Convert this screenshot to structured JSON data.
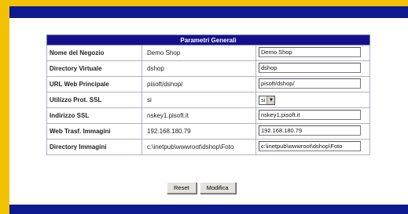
{
  "header": {
    "title": "Parametri Generali"
  },
  "rows": [
    {
      "label": "Nome del Negozio",
      "value": "Demo Shop",
      "field": "Demo Shop"
    },
    {
      "label": "Directory Virtuale",
      "value": "dshop",
      "field": "dshop"
    },
    {
      "label": "URL Web Principale",
      "value": "pisoft/dshop/",
      "field": "pisoft/dshop/"
    },
    {
      "label": "Utilizzo Prot. SSL",
      "value": "si",
      "field": "si"
    },
    {
      "label": "Indirizzo SSL",
      "value": "nskey1.pisoft.it",
      "field": "nskey1.pisoft.it"
    },
    {
      "label": "Web Trasf. Immagini",
      "value": "192.168.180.79",
      "field": "192.168.180.79"
    },
    {
      "label": "Directory Immagini",
      "value": "c:\\inetpub\\wwwroot\\dshop\\Foto",
      "field": "c:\\inetpub\\wwwroot\\dshop\\Foto"
    }
  ],
  "buttons": {
    "reset": "Reset",
    "modifica": "Modifica"
  },
  "colors": {
    "background": "#f2c200",
    "bar": "#0d1a8f",
    "header": "#14108d"
  }
}
